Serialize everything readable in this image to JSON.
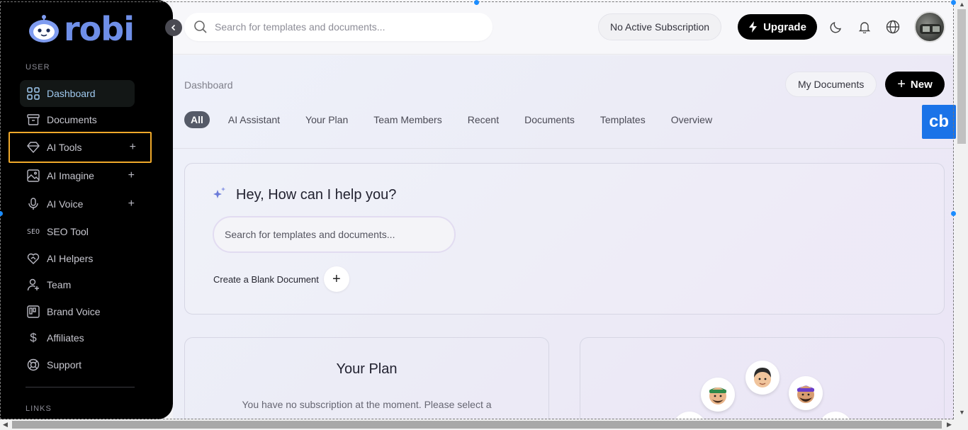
{
  "brand": {
    "name": "robi"
  },
  "sidebar": {
    "section_user": "USER",
    "section_links": "LINKS",
    "items": [
      {
        "label": "Dashboard",
        "icon": "grid-icon"
      },
      {
        "label": "Documents",
        "icon": "archive-icon"
      },
      {
        "label": "AI Tools",
        "icon": "diamond-icon",
        "expand": "+"
      },
      {
        "label": "AI Imagine",
        "icon": "image-icon",
        "expand": "+"
      },
      {
        "label": "AI Voice",
        "icon": "microphone-icon",
        "expand": "+"
      },
      {
        "label": "SEO Tool",
        "icon": "seo-icon",
        "icon_text": "SEO"
      },
      {
        "label": "AI Helpers",
        "icon": "heart-handshake-icon"
      },
      {
        "label": "Team",
        "icon": "user-plus-icon"
      },
      {
        "label": "Brand Voice",
        "icon": "brand-icon"
      },
      {
        "label": "Affiliates",
        "icon": "dollar-icon"
      },
      {
        "label": "Support",
        "icon": "lifebuoy-icon"
      }
    ]
  },
  "topbar": {
    "search_placeholder": "Search for templates and documents...",
    "subscription": "No Active Subscription",
    "upgrade": "Upgrade"
  },
  "main": {
    "breadcrumb": "Dashboard",
    "my_documents": "My Documents",
    "new_button": "New",
    "tabs": [
      "All",
      "AI Assistant",
      "Your Plan",
      "Team Members",
      "Recent",
      "Documents",
      "Templates",
      "Overview"
    ],
    "badge": "cb",
    "help": {
      "title": "Hey, How can I help you?",
      "search_placeholder": "Search for templates and documents...",
      "blank_document": "Create a Blank Document"
    },
    "plan": {
      "title": "Your Plan",
      "text": "You have no subscription at the moment. Please select a"
    }
  },
  "colors": {
    "accent": "#f0a92a",
    "sidebar_bg": "#000000",
    "brand": "#6f8fe8",
    "active_item": "#9fc9ef"
  }
}
